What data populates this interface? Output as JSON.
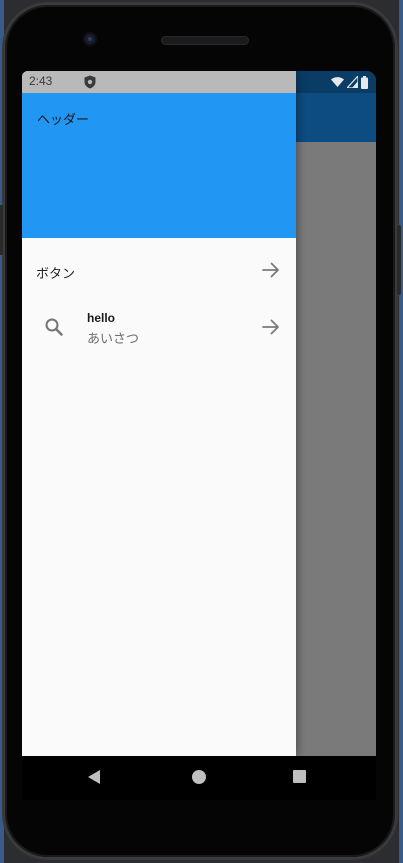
{
  "status_bar": {
    "time": "2:43"
  },
  "drawer": {
    "header_title": "ヘッダー",
    "items": [
      {
        "label": "ボタン",
        "trailing_icon": "arrow-forward-icon"
      },
      {
        "leading_icon": "search-icon",
        "title": "hello",
        "subtitle": "あいさつ",
        "trailing_icon": "arrow-forward-icon"
      }
    ]
  },
  "colors": {
    "drawer_header": "#2196f3",
    "app_bar": "#0d4c80",
    "scrim": "#7a7a7a",
    "drawer_bg": "#fafafa"
  },
  "nav_bar": {
    "buttons": [
      "back-icon",
      "home-icon",
      "recents-icon"
    ]
  }
}
